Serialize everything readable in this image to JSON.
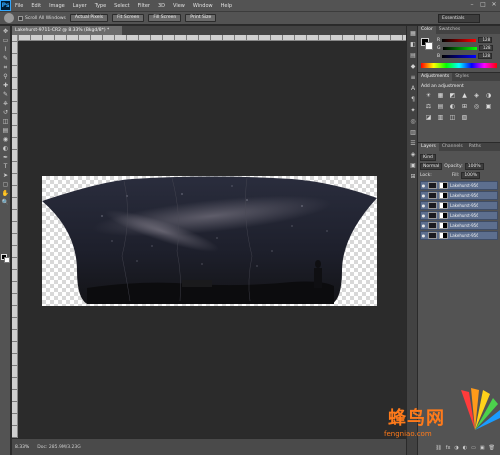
{
  "app": {
    "logo": "Ps"
  },
  "menu": [
    "File",
    "Edit",
    "Image",
    "Layer",
    "Type",
    "Select",
    "Filter",
    "3D",
    "View",
    "Window",
    "Help"
  ],
  "window_controls": [
    "–",
    "□",
    "✕"
  ],
  "options": {
    "scroll_all_windows": "Scroll All Windows",
    "buttons": [
      "Actual Pixels",
      "Fit Screen",
      "Fill Screen",
      "Print Size"
    ],
    "workspace": "Essentials"
  },
  "document": {
    "tab_title": "Lakehurst-9711-CR2 @ 8.33% (Bkgd/8*) *"
  },
  "status": {
    "zoom": "8.33%",
    "doc_size": "Doc: 285.9M/3.23G"
  },
  "tools": [
    "move-icon",
    "marquee-icon",
    "lasso-icon",
    "quick-select-icon",
    "crop-icon",
    "eyedropper-icon",
    "healing-icon",
    "brush-icon",
    "stamp-icon",
    "history-brush-icon",
    "eraser-icon",
    "gradient-icon",
    "blur-icon",
    "dodge-icon",
    "pen-icon",
    "type-icon",
    "path-select-icon",
    "shape-icon",
    "hand-icon",
    "zoom-icon"
  ],
  "tool_glyphs": [
    "✥",
    "▭",
    "⌇",
    "✎",
    "⌗",
    "⚲",
    "✚",
    "✎",
    "⎈",
    "↺",
    "◫",
    "▤",
    "◉",
    "◐",
    "✒",
    "T",
    "➤",
    "▢",
    "✋",
    "🔍"
  ],
  "strip_glyphs": [
    "▦",
    "◧",
    "▤",
    "◆",
    "≡",
    "A",
    "¶",
    "✦",
    "◎",
    "▥",
    "☰",
    "◈",
    "▣",
    "⊞"
  ],
  "color_panel": {
    "tabs": [
      "Color",
      "Swatches"
    ],
    "sliders": [
      {
        "label": "R",
        "value": "128",
        "color": "#ff3b3b"
      },
      {
        "label": "G",
        "value": "128",
        "color": "#3bff3b"
      },
      {
        "label": "B",
        "value": "128",
        "color": "#3b6bff"
      }
    ]
  },
  "adjustments_panel": {
    "tabs": [
      "Adjustments",
      "Styles"
    ],
    "title": "Add an adjustment",
    "icons": [
      "☀",
      "▦",
      "◩",
      "▲",
      "◈",
      "◑",
      "⚖",
      "▤",
      "◐",
      "⊞",
      "◎",
      "▣",
      "◪",
      "▥",
      "◫",
      "▧"
    ]
  },
  "layers_panel": {
    "tabs": [
      "Layers",
      "Channels",
      "Paths"
    ],
    "kind_filter": "Kind",
    "blend_mode": "Normal",
    "opacity_label": "Opacity:",
    "opacity_value": "100%",
    "lock_label": "Lock:",
    "fill_label": "Fill:",
    "fill_value": "100%",
    "layers": [
      "Lakehurst-9563...",
      "Lakehurst-9564...",
      "Lakehurst-9565...",
      "Lakehurst-9566...",
      "Lakehurst-9567...",
      "Lakehurst-9568..."
    ],
    "footer_icons": [
      "⛓",
      "fx",
      "◑",
      "◐",
      "▭",
      "▣",
      "🗑"
    ]
  },
  "watermark": {
    "title": "蜂鸟网",
    "url": "fengniao.com"
  },
  "colors": {
    "accent": "#31a8ff",
    "layer_selected": "#5d6f8f",
    "watermark": "#ff7a1a"
  }
}
